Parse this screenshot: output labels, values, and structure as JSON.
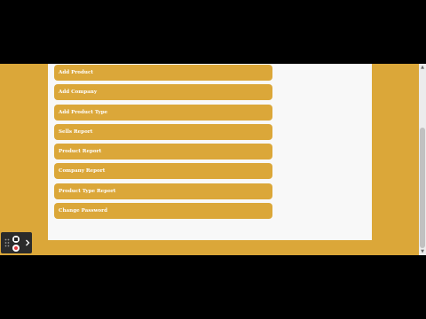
{
  "menu": {
    "items": [
      {
        "label": "Add Product"
      },
      {
        "label": "Add Company"
      },
      {
        "label": "Add Product Type"
      },
      {
        "label": "Sells Report"
      },
      {
        "label": "Product Report"
      },
      {
        "label": "Company Report"
      },
      {
        "label": "Product Type Report"
      },
      {
        "label": "Change Password"
      }
    ]
  },
  "colors": {
    "accent": "#dba739",
    "panel": "#f8f8f8",
    "letterbox": "#000000",
    "overlay": "#2b2b2b",
    "record": "#e0393e"
  },
  "icons": [
    "cursor-icon",
    "drag-handle-icon",
    "pause-icon",
    "record-icon",
    "chevron-right-icon",
    "scroll-up-icon",
    "scroll-down-icon"
  ]
}
